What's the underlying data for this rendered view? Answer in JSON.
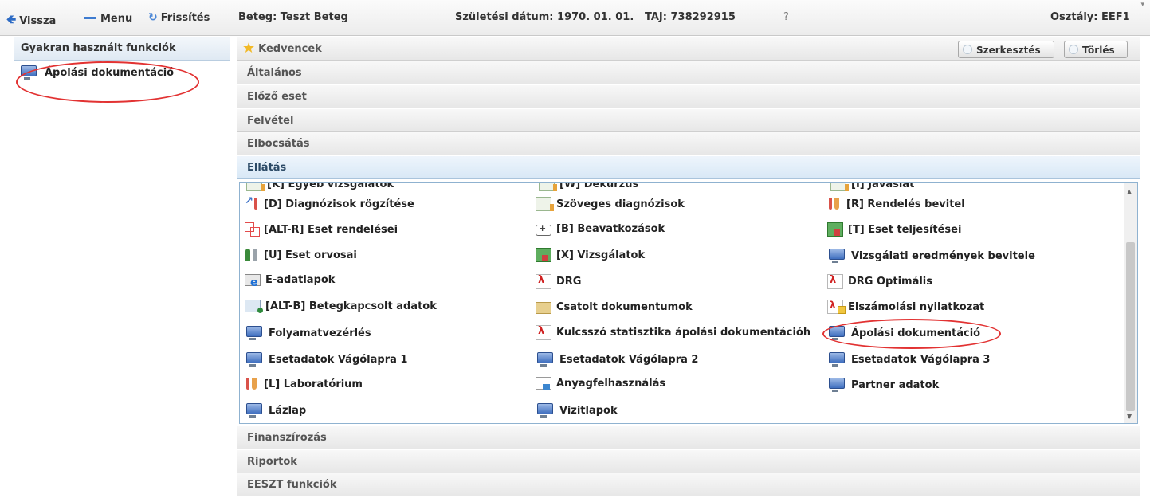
{
  "toolbar": {
    "back_label": "Vissza",
    "menu_label": "Menu",
    "refresh_label": "Frissítés",
    "patient_text": "Beteg: Teszt Beteg",
    "birth_text": "Születési dátum: 1970. 01. 01.",
    "taj_text": "TAJ: 738292915",
    "help_text": "?",
    "department_text": "Osztály: EEF1",
    "mini_arrow": "▾"
  },
  "left_panel": {
    "title": "Gyakran használt funkciók",
    "items": [
      {
        "label": "Ápolási dokumentáció",
        "icon": "monitor-icon"
      }
    ]
  },
  "accordion": {
    "kedvencek": "Kedvencek",
    "edit_button": "Szerkesztés",
    "delete_button": "Törlés",
    "sections_top": [
      "Általános",
      "Előző eset",
      "Felvétel",
      "Elbocsátás",
      "Ellátás"
    ],
    "sections_bottom": [
      "Finanszírozás",
      "Riportok",
      "EESZT funkciók"
    ]
  },
  "ellatas": {
    "partial_row": [
      "[K] Egyéb vizsgálatok",
      "[W] Dekurzus",
      "[I] Javaslat"
    ],
    "col1": [
      {
        "label": "[D] Diagnózisok rögzítése",
        "icon": "diagnosis-icon"
      },
      {
        "label": "[ALT-R] Eset rendelései",
        "icon": "orders-icon"
      },
      {
        "label": "[U] Eset orvosai",
        "icon": "doctors-icon"
      },
      {
        "label": "E-adatlapok",
        "icon": "e-form-icon"
      },
      {
        "label": "[ALT-B] Betegkapcsolt adatok",
        "icon": "patient-data-icon"
      },
      {
        "label": "Folyamatvezérlés",
        "icon": "monitor-icon"
      },
      {
        "label": "Esetadatok Vágólapra 1",
        "icon": "monitor-icon"
      },
      {
        "label": "[L] Laboratórium",
        "icon": "test-tubes-icon"
      },
      {
        "label": "Lázlap",
        "icon": "monitor-icon"
      }
    ],
    "col2": [
      {
        "label": "Szöveges diagnózisok",
        "icon": "text-diagnosis-icon"
      },
      {
        "label": "[B] Beavatkozások",
        "icon": "first-aid-kit-icon"
      },
      {
        "label": "[X] Vizsgálatok",
        "icon": "examination-icon"
      },
      {
        "label": "DRG",
        "icon": "pdf-icon"
      },
      {
        "label": "Csatolt dokumentumok",
        "icon": "folder-icon"
      },
      {
        "label": "Kulcsszó statisztika ápolási dokumentációh",
        "icon": "pdf-icon"
      },
      {
        "label": "Esetadatok Vágólapra 2",
        "icon": "monitor-icon"
      },
      {
        "label": "Anyagfelhasználás",
        "icon": "materials-icon"
      },
      {
        "label": "Vizitlapok",
        "icon": "monitor-icon"
      }
    ],
    "col3": [
      {
        "label": "[R] Rendelés bevitel",
        "icon": "test-tubes-icon"
      },
      {
        "label": "[T] Eset teljesítései",
        "icon": "calculator-icon"
      },
      {
        "label": "Vizsgálati eredmények bevitele",
        "icon": "monitor-icon"
      },
      {
        "label": "DRG Optimális",
        "icon": "pdf-icon"
      },
      {
        "label": "Elszámolási nyilatkozat",
        "icon": "pdf-statement-icon"
      },
      {
        "label": "Ápolási dokumentáció",
        "icon": "monitor-icon"
      },
      {
        "label": "Esetadatok Vágólapra 3",
        "icon": "monitor-icon"
      },
      {
        "label": "Partner adatok",
        "icon": "monitor-icon"
      }
    ]
  },
  "colors": {
    "highlight_circle": "#e23232",
    "active_header_bg": "#d8e8f6",
    "panel_border": "#8fb2d0"
  }
}
